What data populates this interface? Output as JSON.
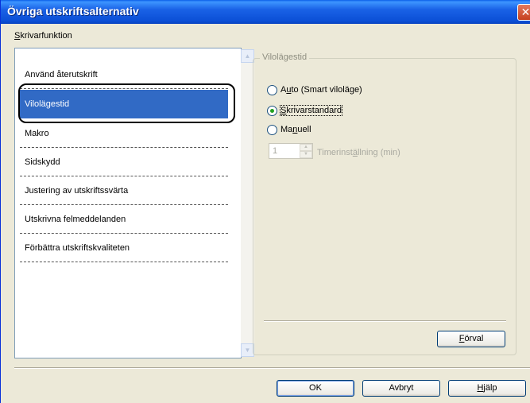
{
  "window": {
    "title": "Övriga utskriftsalternativ",
    "close_glyph": "✕"
  },
  "left_panel": {
    "label": "Skrivarfunktion",
    "label_mnemonic": "S",
    "label_rest": "krivarfunktion",
    "items": [
      {
        "label": "Använd återutskrift",
        "selected": false
      },
      {
        "label": "Vilolägestid",
        "selected": true
      },
      {
        "label": "Makro",
        "selected": false
      },
      {
        "label": "Sidskydd",
        "selected": false
      },
      {
        "label": "Justering av utskriftssvärta",
        "selected": false
      },
      {
        "label": "Utskrivna felmeddelanden",
        "selected": false
      },
      {
        "label": "Förbättra utskriftskvaliteten",
        "selected": false
      }
    ]
  },
  "group": {
    "title": "Vilolägestid",
    "options": [
      {
        "label": "Auto (Smart viloläge)",
        "pre": "A",
        "mn": "u",
        "post": "to (Smart viloläge)",
        "checked": false
      },
      {
        "label": "Skrivarstandard",
        "pre": "",
        "mn": "S",
        "post": "krivarstandard",
        "checked": true
      },
      {
        "label": "Manuell",
        "pre": "Ma",
        "mn": "n",
        "post": "uell",
        "checked": false
      }
    ],
    "timer": {
      "value": "1",
      "label": "Timerinställning (min)",
      "label_pre": "Timerinst",
      "label_mn": "ä",
      "label_post": "llning (min)"
    },
    "default_button": {
      "label": "Förval",
      "mn": "F",
      "rest": "örval"
    }
  },
  "buttons": {
    "ok": "OK",
    "cancel": "Avbryt",
    "help": {
      "label": "Hjälp",
      "mn": "H",
      "rest": "jälp"
    }
  },
  "colors": {
    "titlebar": "#0b4fd6",
    "selection": "#316ac5",
    "radio_dot": "#21a121",
    "dialog_bg": "#ece9d8"
  },
  "icons": [
    "close-icon",
    "scroll-up-icon",
    "scroll-down-icon",
    "spin-up-icon",
    "spin-down-icon"
  ]
}
